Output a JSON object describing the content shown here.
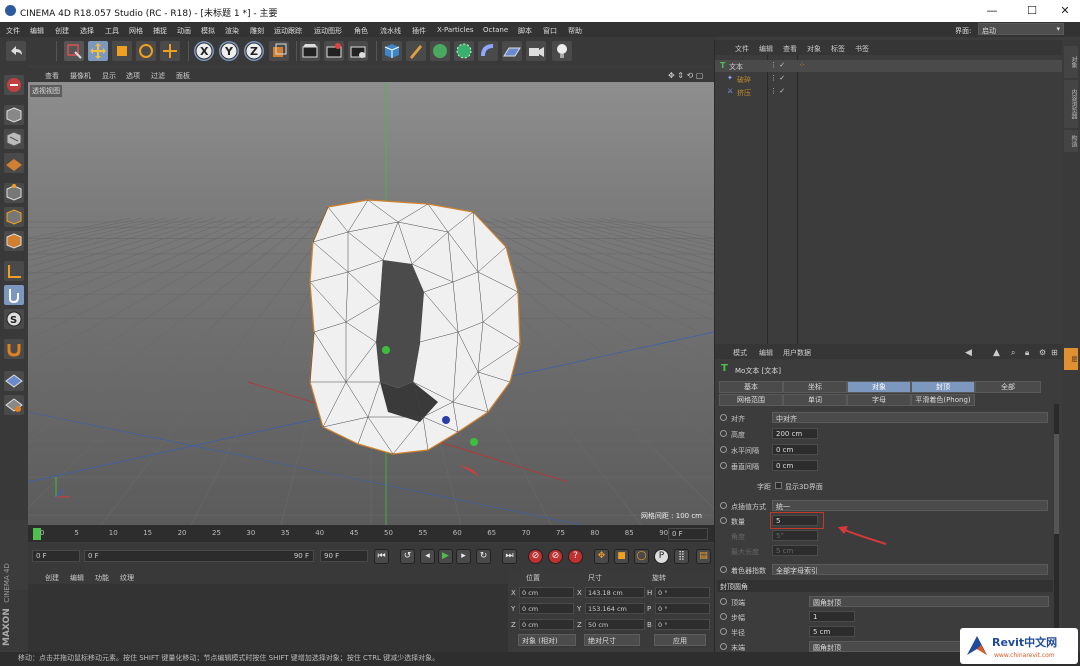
{
  "window": {
    "title": "CINEMA 4D R18.057 Studio (RC - R18) - [未标题 1 *] - 主要"
  },
  "menubar": {
    "items": [
      "文件",
      "编辑",
      "创建",
      "选择",
      "工具",
      "网格",
      "捕捉",
      "动画",
      "模拟",
      "渲染",
      "雕刻",
      "运动跟踪",
      "运动图形",
      "角色",
      "流水线",
      "插件",
      "X-Particles",
      "Octane",
      "脚本",
      "窗口",
      "帮助"
    ],
    "layout_label": "界面:",
    "layout_value": "启动"
  },
  "viewport": {
    "menu": [
      "查看",
      "摄像机",
      "显示",
      "选项",
      "过滤",
      "面板"
    ],
    "label": "透视视图",
    "grid_spacing": "网格间距 : 100 cm"
  },
  "timeline": {
    "ticks": [
      "0",
      "5",
      "10",
      "15",
      "20",
      "25",
      "30",
      "35",
      "40",
      "45",
      "50",
      "55",
      "60",
      "65",
      "70",
      "75",
      "80",
      "85",
      "90"
    ],
    "end_field": "0 F",
    "current_frame": "0 F",
    "range_start": "0 F",
    "range_end": "90 F",
    "max_frame": "90 F"
  },
  "material": {
    "menu": [
      "创建",
      "编辑",
      "功能",
      "纹理"
    ]
  },
  "brand": {
    "line1": "MAXON",
    "line2": "CINEMA 4D"
  },
  "coords": {
    "headers": [
      "位置",
      "尺寸",
      "旋转"
    ],
    "rows": [
      {
        "axis": "X",
        "pos": "0 cm",
        "size_axis": "X",
        "size": "143.18 cm",
        "rot_axis": "H",
        "rot": "0 °"
      },
      {
        "axis": "Y",
        "pos": "0 cm",
        "size_axis": "Y",
        "size": "153.164 cm",
        "rot_axis": "P",
        "rot": "0 °"
      },
      {
        "axis": "Z",
        "pos": "0 cm",
        "size_axis": "Z",
        "size": "50 cm",
        "rot_axis": "B",
        "rot": "0 °"
      }
    ],
    "mode": "对象 (相对)",
    "size_mode": "绝对尺寸",
    "apply": "应用"
  },
  "object_manager": {
    "menu": [
      "文件",
      "编辑",
      "查看",
      "对象",
      "标签",
      "书签"
    ],
    "objects": [
      {
        "name": "文本",
        "color": "#e0a040"
      },
      {
        "name": "破碎",
        "color": "#c08a30"
      },
      {
        "name": "挤压",
        "color": "#c08a30"
      }
    ]
  },
  "attributes": {
    "menu": [
      "模式",
      "编辑",
      "用户数据"
    ],
    "title": "Mo文本 [文本]",
    "tabs_row1": [
      "基本",
      "坐标",
      "对象",
      "封顶",
      "全部"
    ],
    "tabs_row2": [
      "网格范围",
      "单词",
      "字母",
      "平滑着色(Phong)"
    ],
    "active_tabs": [
      "对象",
      "封顶"
    ],
    "rows": [
      {
        "label": "对齐",
        "value": "中对齐",
        "kind": "dropdown"
      },
      {
        "label": "高度",
        "value": "200 cm",
        "kind": "number"
      },
      {
        "label": "水平间隔",
        "value": "0 cm",
        "kind": "number"
      },
      {
        "label": "垂直间隔",
        "value": "0 cm",
        "kind": "number"
      }
    ],
    "kerning_label": "字距",
    "kerning_check": "显示3D界面",
    "interp_label": "点插值方式",
    "interp_value": "统一",
    "count_label": "数量",
    "count_value": "5",
    "angle_label": "角度",
    "angle_value": "5°",
    "maxlen_label": "最大长度",
    "maxlen_value": "5 cm",
    "shader_label": "着色器指数",
    "shader_value": "全部字母索引",
    "section_title": "封顶圆角",
    "cap_rows": [
      {
        "label": "顶端",
        "value": "圆角封顶",
        "kind": "dropdown"
      },
      {
        "label": "步幅",
        "value": "1",
        "kind": "number"
      },
      {
        "label": "半径",
        "value": "5 cm",
        "kind": "number"
      },
      {
        "label": "末端",
        "value": "圆角封顶",
        "kind": "dropdown"
      },
      {
        "label": "步幅",
        "value": "",
        "kind": "number"
      }
    ]
  },
  "sidetabs": [
    "对象",
    "内容浏览器",
    "构造",
    "层"
  ],
  "status": {
    "text": "移动：点击并拖动鼠标移动元素。按住 SHIFT 键量化移动；节点编辑模式时按住 SHIFT 键增加选择对象；按住 CTRL 键减少选择对象。"
  },
  "watermark": {
    "brand": "Revit中文网",
    "url": "www.chinarevit.com"
  },
  "colors": {
    "accent": "#7d98bf",
    "highlight_box": "#c0392b",
    "arrow": "#d83a3a",
    "orange": "#e0a040"
  }
}
